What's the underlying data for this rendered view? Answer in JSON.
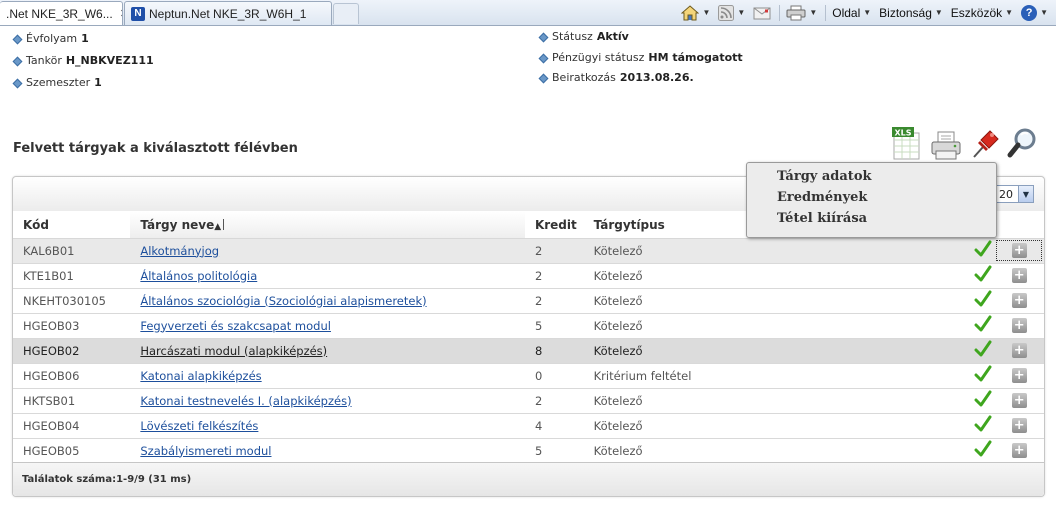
{
  "browser": {
    "tabs": [
      {
        "label": ".Net NKE_3R_W6...",
        "active": true
      },
      {
        "label": "Neptun.Net NKE_3R_W6H_1",
        "active": false
      }
    ],
    "close_glyph": "✕",
    "commands": {
      "page": "Oldal",
      "security": "Biztonság",
      "tools": "Eszközök",
      "help": "?"
    }
  },
  "student_info": {
    "left": [
      {
        "label": "Évfolyam",
        "value": "1"
      },
      {
        "label": "Tankör",
        "value": "H_NBKVEZ111"
      },
      {
        "label": "Szemeszter",
        "value": "1"
      }
    ],
    "right": [
      {
        "label": "Státusz",
        "value": "Aktív"
      },
      {
        "label": "Pénzügyi státusz",
        "value": "HM támogatott"
      },
      {
        "label": "Beiratkozás",
        "value": "2013.08.26."
      }
    ]
  },
  "section": {
    "title": "Felvett tárgyak a kiválasztott félévben",
    "toolbar": {
      "export_label": "XLS"
    }
  },
  "pager": {
    "page_size": "20"
  },
  "table": {
    "columns": [
      "Kód",
      "Tárgy neve",
      "Kredit",
      "Tárgytípus"
    ],
    "sorted_column_glyph": "▲",
    "rows": [
      {
        "code": "KAL6B01",
        "name": "Alkotmányjog",
        "credit": "2",
        "type": "Kötelező",
        "checked": true
      },
      {
        "code": "KTE1B01",
        "name": "Általános politológia",
        "credit": "2",
        "type": "Kötelező",
        "checked": true
      },
      {
        "code": "NKEHT030105",
        "name": "Általános szociológia (Szociológiai alapismeretek)",
        "credit": "2",
        "type": "Kötelező",
        "checked": true
      },
      {
        "code": "HGEOB03",
        "name": "Fegyverzeti és szakcsapat modul",
        "credit": "5",
        "type": "Kötelező",
        "checked": true
      },
      {
        "code": "HGEOB02",
        "name": "Harcászati modul (alapkiképzés)",
        "credit": "8",
        "type": "Kötelező",
        "checked": true
      },
      {
        "code": "HGEOB06",
        "name": "Katonai alapkiképzés",
        "credit": "0",
        "type": "Kritérium feltétel",
        "checked": true
      },
      {
        "code": "HKTSB01",
        "name": "Katonai testnevelés I. (alapkiképzés)",
        "credit": "2",
        "type": "Kötelező",
        "checked": true
      },
      {
        "code": "HGEOB04",
        "name": "Lövészeti felkészítés",
        "credit": "4",
        "type": "Kötelező",
        "checked": true
      },
      {
        "code": "HGEOB05",
        "name": "Szabályismereti modul",
        "credit": "5",
        "type": "Kötelező",
        "checked": true
      }
    ],
    "plus_glyph": "+"
  },
  "footer": {
    "results": "Találatok száma:1-9/9 (31 ms)"
  },
  "context_menu": {
    "items": [
      "Tárgy adatok",
      "Eredmények",
      "Tétel kiírása"
    ]
  },
  "colors": {
    "link": "#1d4f9c",
    "check": "#3fa61e",
    "selected_row": "#dcdcdc"
  }
}
